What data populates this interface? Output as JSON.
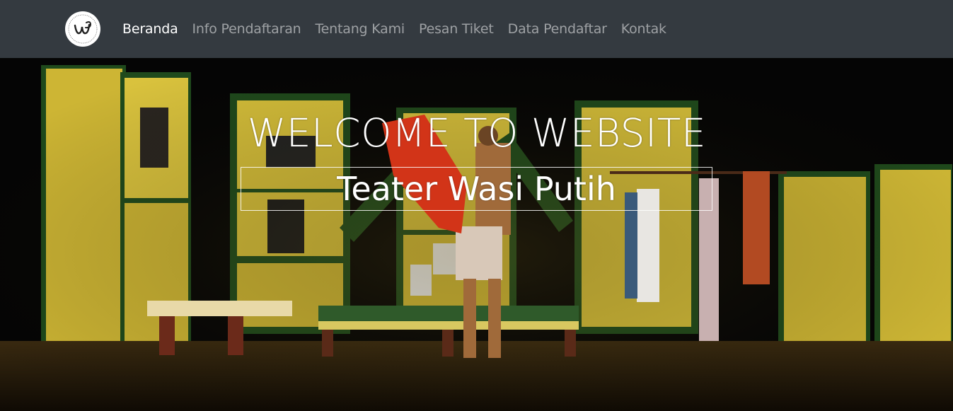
{
  "navbar": {
    "logo_icon": "teater-wasi-putih-logo",
    "items": [
      {
        "label": "Beranda",
        "active": true
      },
      {
        "label": "Info Pendaftaran",
        "active": false
      },
      {
        "label": "Tentang Kami",
        "active": false
      },
      {
        "label": "Pesan Tiket",
        "active": false
      },
      {
        "label": "Data Pendaftar",
        "active": false
      },
      {
        "label": "Kontak",
        "active": false
      }
    ]
  },
  "hero": {
    "title": "WELCOME TO WEBSITE",
    "subtitle": "Teater Wasi Putih",
    "background_image": "theater-stage-photo"
  },
  "colors": {
    "navbar_bg": "#343a40",
    "nav_active": "#ffffff",
    "nav_inactive": "rgba(255,255,255,0.52)",
    "stage_yellow": "#d8c03a",
    "stage_green": "#1f4a1c"
  }
}
